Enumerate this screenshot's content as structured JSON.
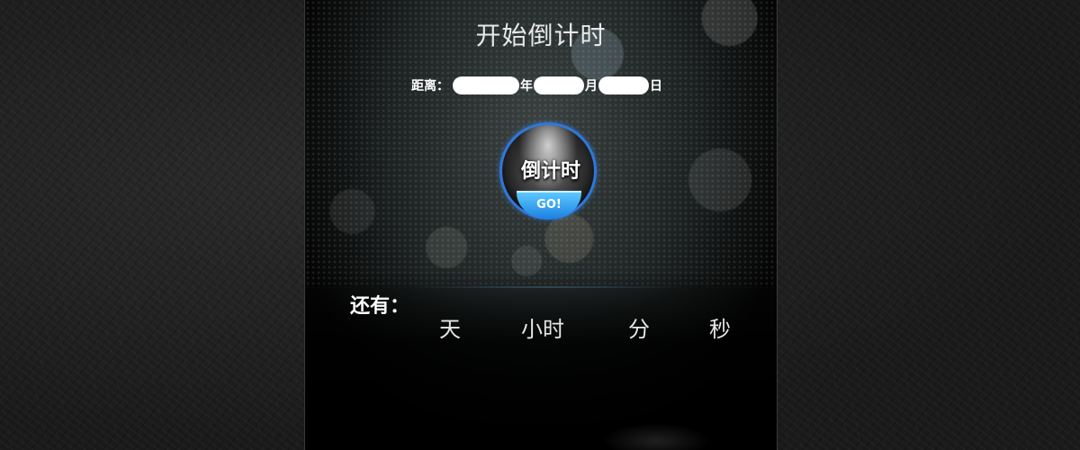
{
  "title": "开始倒计时",
  "date_form": {
    "label": "距离：",
    "year_value": "",
    "year_unit": "年",
    "month_value": "",
    "month_unit": "月",
    "day_value": "",
    "day_unit": "日"
  },
  "go_button": {
    "main_text": "倒计时",
    "badge_text": "GO!"
  },
  "remaining": {
    "label": "还有：",
    "days_value": "",
    "days_unit": "天",
    "hours_value": "",
    "hours_unit": "小时",
    "minutes_value": "",
    "minutes_unit": "分",
    "seconds_value": "",
    "seconds_unit": "秒"
  },
  "colors": {
    "accent_blue": "#2f78d8",
    "badge_blue": "#1b7fe0"
  }
}
